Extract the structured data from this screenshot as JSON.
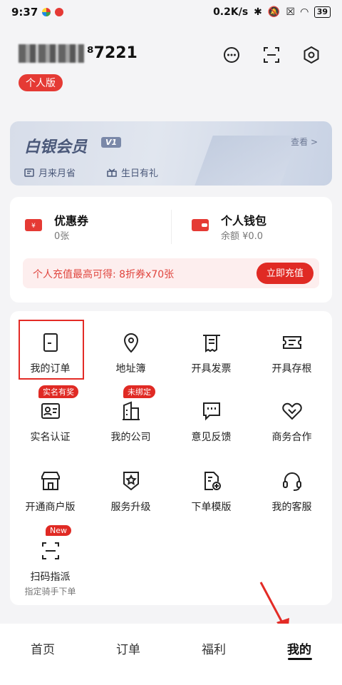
{
  "status_bar": {
    "time": "9:37",
    "network_speed": "0.2K/s",
    "battery": "39"
  },
  "header": {
    "user_id": "⁸7221",
    "badge": "个人版",
    "icons": [
      "message-icon",
      "scan-icon",
      "settings-icon"
    ]
  },
  "member": {
    "title": "白银会员",
    "level": "V1",
    "view": "查看 >",
    "perks": [
      "月来月省",
      "生日有礼"
    ]
  },
  "wallet": {
    "coupon_title": "优惠券",
    "coupon_sub": "0张",
    "purse_title": "个人钱包",
    "purse_sub": "余额 ¥0.0",
    "promo_text": "个人充值最高可得: 8折券x70张",
    "promo_button": "立即充值"
  },
  "grid": {
    "items": [
      {
        "label": "我的订单",
        "icon": "order-doc-icon"
      },
      {
        "label": "地址簿",
        "icon": "location-pin-icon"
      },
      {
        "label": "开具发票",
        "icon": "invoice-icon"
      },
      {
        "label": "开具存根",
        "icon": "ticket-stub-icon"
      },
      {
        "label": "实名认证",
        "icon": "id-card-icon",
        "tag": "实名有奖"
      },
      {
        "label": "我的公司",
        "icon": "building-icon",
        "tag": "未绑定"
      },
      {
        "label": "意见反馈",
        "icon": "feedback-icon"
      },
      {
        "label": "商务合作",
        "icon": "handshake-heart-icon"
      },
      {
        "label": "开通商户版",
        "icon": "storefront-icon"
      },
      {
        "label": "服务升级",
        "icon": "star-badge-icon"
      },
      {
        "label": "下单模版",
        "icon": "template-add-icon"
      },
      {
        "label": "我的客服",
        "icon": "headset-icon"
      },
      {
        "label": "扫码指派",
        "icon": "scan-assign-icon",
        "tag": "New",
        "sub": "指定骑手下单"
      }
    ]
  },
  "tabbar": {
    "tabs": [
      "首页",
      "订单",
      "福利",
      "我的"
    ],
    "active": "我的"
  },
  "colors": {
    "accent": "#e02a24",
    "highlight_box": "#e32b26",
    "member_text": "#4a5879"
  }
}
